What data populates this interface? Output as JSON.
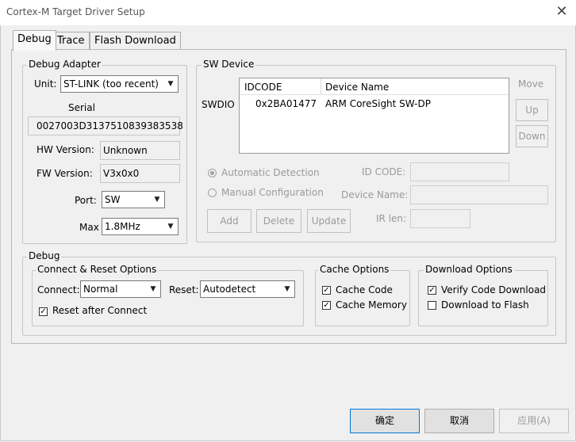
{
  "window": {
    "title": "Cortex-M Target Driver Setup"
  },
  "tabs": [
    "Debug",
    "Trace",
    "Flash Download"
  ],
  "debug_adapter": {
    "group_label": "Debug Adapter",
    "unit_label": "Unit:",
    "unit_value": "ST-LINK (too recent)",
    "serial_label": "Serial",
    "serial_value": "0027003D3137510839383538",
    "hw_label": "HW Version:",
    "hw_value": "Unknown",
    "fw_label": "FW Version:",
    "fw_value": "V3x0x0",
    "port_label": "Port:",
    "port_value": "SW",
    "max_label": "Max",
    "max_value": "1.8MHz"
  },
  "sw_device": {
    "group_label": "SW Device",
    "row_label": "SWDIO",
    "columns": [
      "IDCODE",
      "Device Name"
    ],
    "rows": [
      {
        "idcode": "0x2BA01477",
        "name": "ARM CoreSight SW-DP"
      }
    ],
    "move_label": "Move",
    "up_label": "Up",
    "down_label": "Down",
    "auto_detect_label": "Automatic Detection",
    "manual_config_label": "Manual Configuration",
    "id_code_label": "ID CODE:",
    "device_name_label": "Device Name:",
    "ir_len_label": "IR len:",
    "add_label": "Add",
    "delete_label": "Delete",
    "update_label": "Update"
  },
  "debug": {
    "group_label": "Debug",
    "connect_reset": {
      "group_label": "Connect & Reset Options",
      "connect_label": "Connect:",
      "connect_value": "Normal",
      "reset_label": "Reset:",
      "reset_value": "Autodetect",
      "reset_after_connect_label": "Reset after Connect"
    },
    "cache": {
      "group_label": "Cache Options",
      "cache_code_label": "Cache Code",
      "cache_memory_label": "Cache Memory"
    },
    "download": {
      "group_label": "Download Options",
      "verify_label": "Verify Code Download",
      "download_flash_label": "Download to Flash"
    }
  },
  "footer": {
    "ok_label": "确定",
    "cancel_label": "取消",
    "apply_label": "应用(A)"
  }
}
